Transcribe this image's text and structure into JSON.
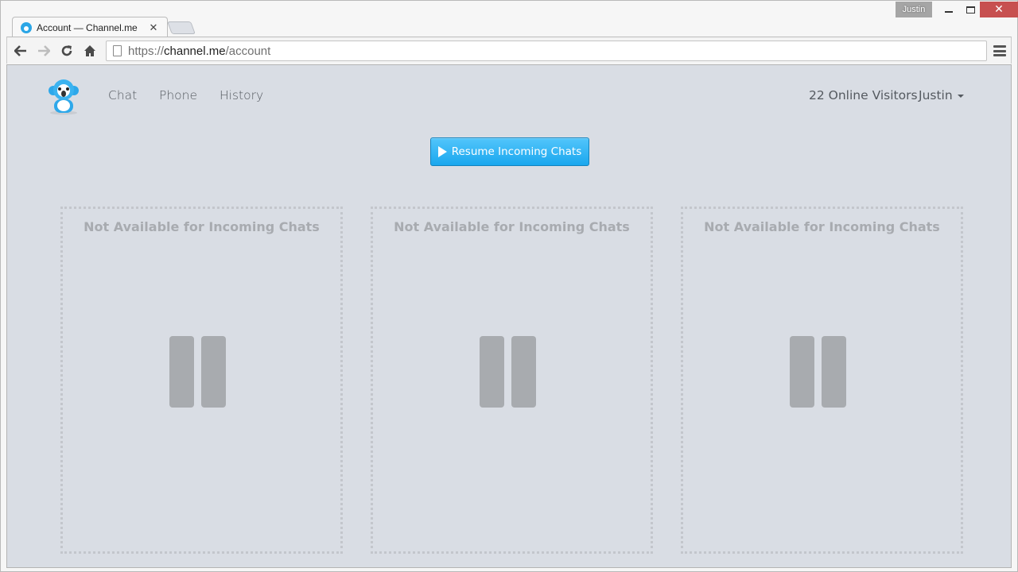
{
  "browser": {
    "profile_name": "Justin",
    "tab": {
      "title": "Account — Channel.me",
      "close_glyph": "✕"
    },
    "address_bar": {
      "scheme": "https://",
      "host": "channel.me",
      "path": "/account"
    },
    "window_controls": {
      "close_glyph": "✕"
    },
    "nav_icons": {
      "back": "🡐",
      "forward": "🡒",
      "reload": "↻",
      "home": "⌂"
    }
  },
  "header": {
    "logo_alt": "Channel.me mascot",
    "nav": [
      {
        "label": "Chat"
      },
      {
        "label": "Phone"
      },
      {
        "label": "History"
      }
    ],
    "visitors_text": "22 Online Visitors",
    "user_name": "Justin"
  },
  "main": {
    "resume_button_label": "Resume Incoming Chats",
    "panels": [
      {
        "title": "Not Available for Incoming Chats",
        "icon": "pause-icon"
      },
      {
        "title": "Not Available for Incoming Chats",
        "icon": "pause-icon"
      },
      {
        "title": "Not Available for Incoming Chats",
        "icon": "pause-icon"
      }
    ]
  },
  "colors": {
    "accent": "#1aa7ee",
    "page_bg": "#d9dde4",
    "muted_text": "#a8abb0",
    "close_button": "#c75050"
  }
}
